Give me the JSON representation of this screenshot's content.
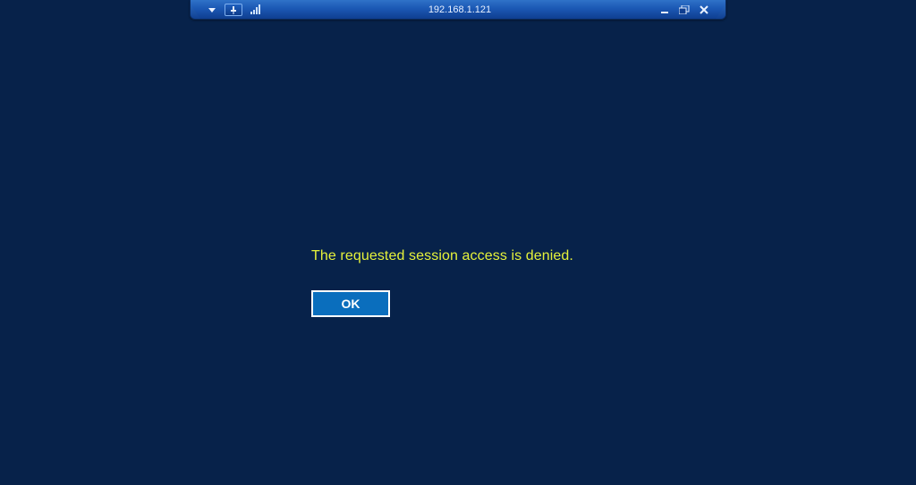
{
  "rdp_bar": {
    "title": "192.168.1.121"
  },
  "dialog": {
    "message": "The requested session access is denied.",
    "ok_label": "OK"
  }
}
